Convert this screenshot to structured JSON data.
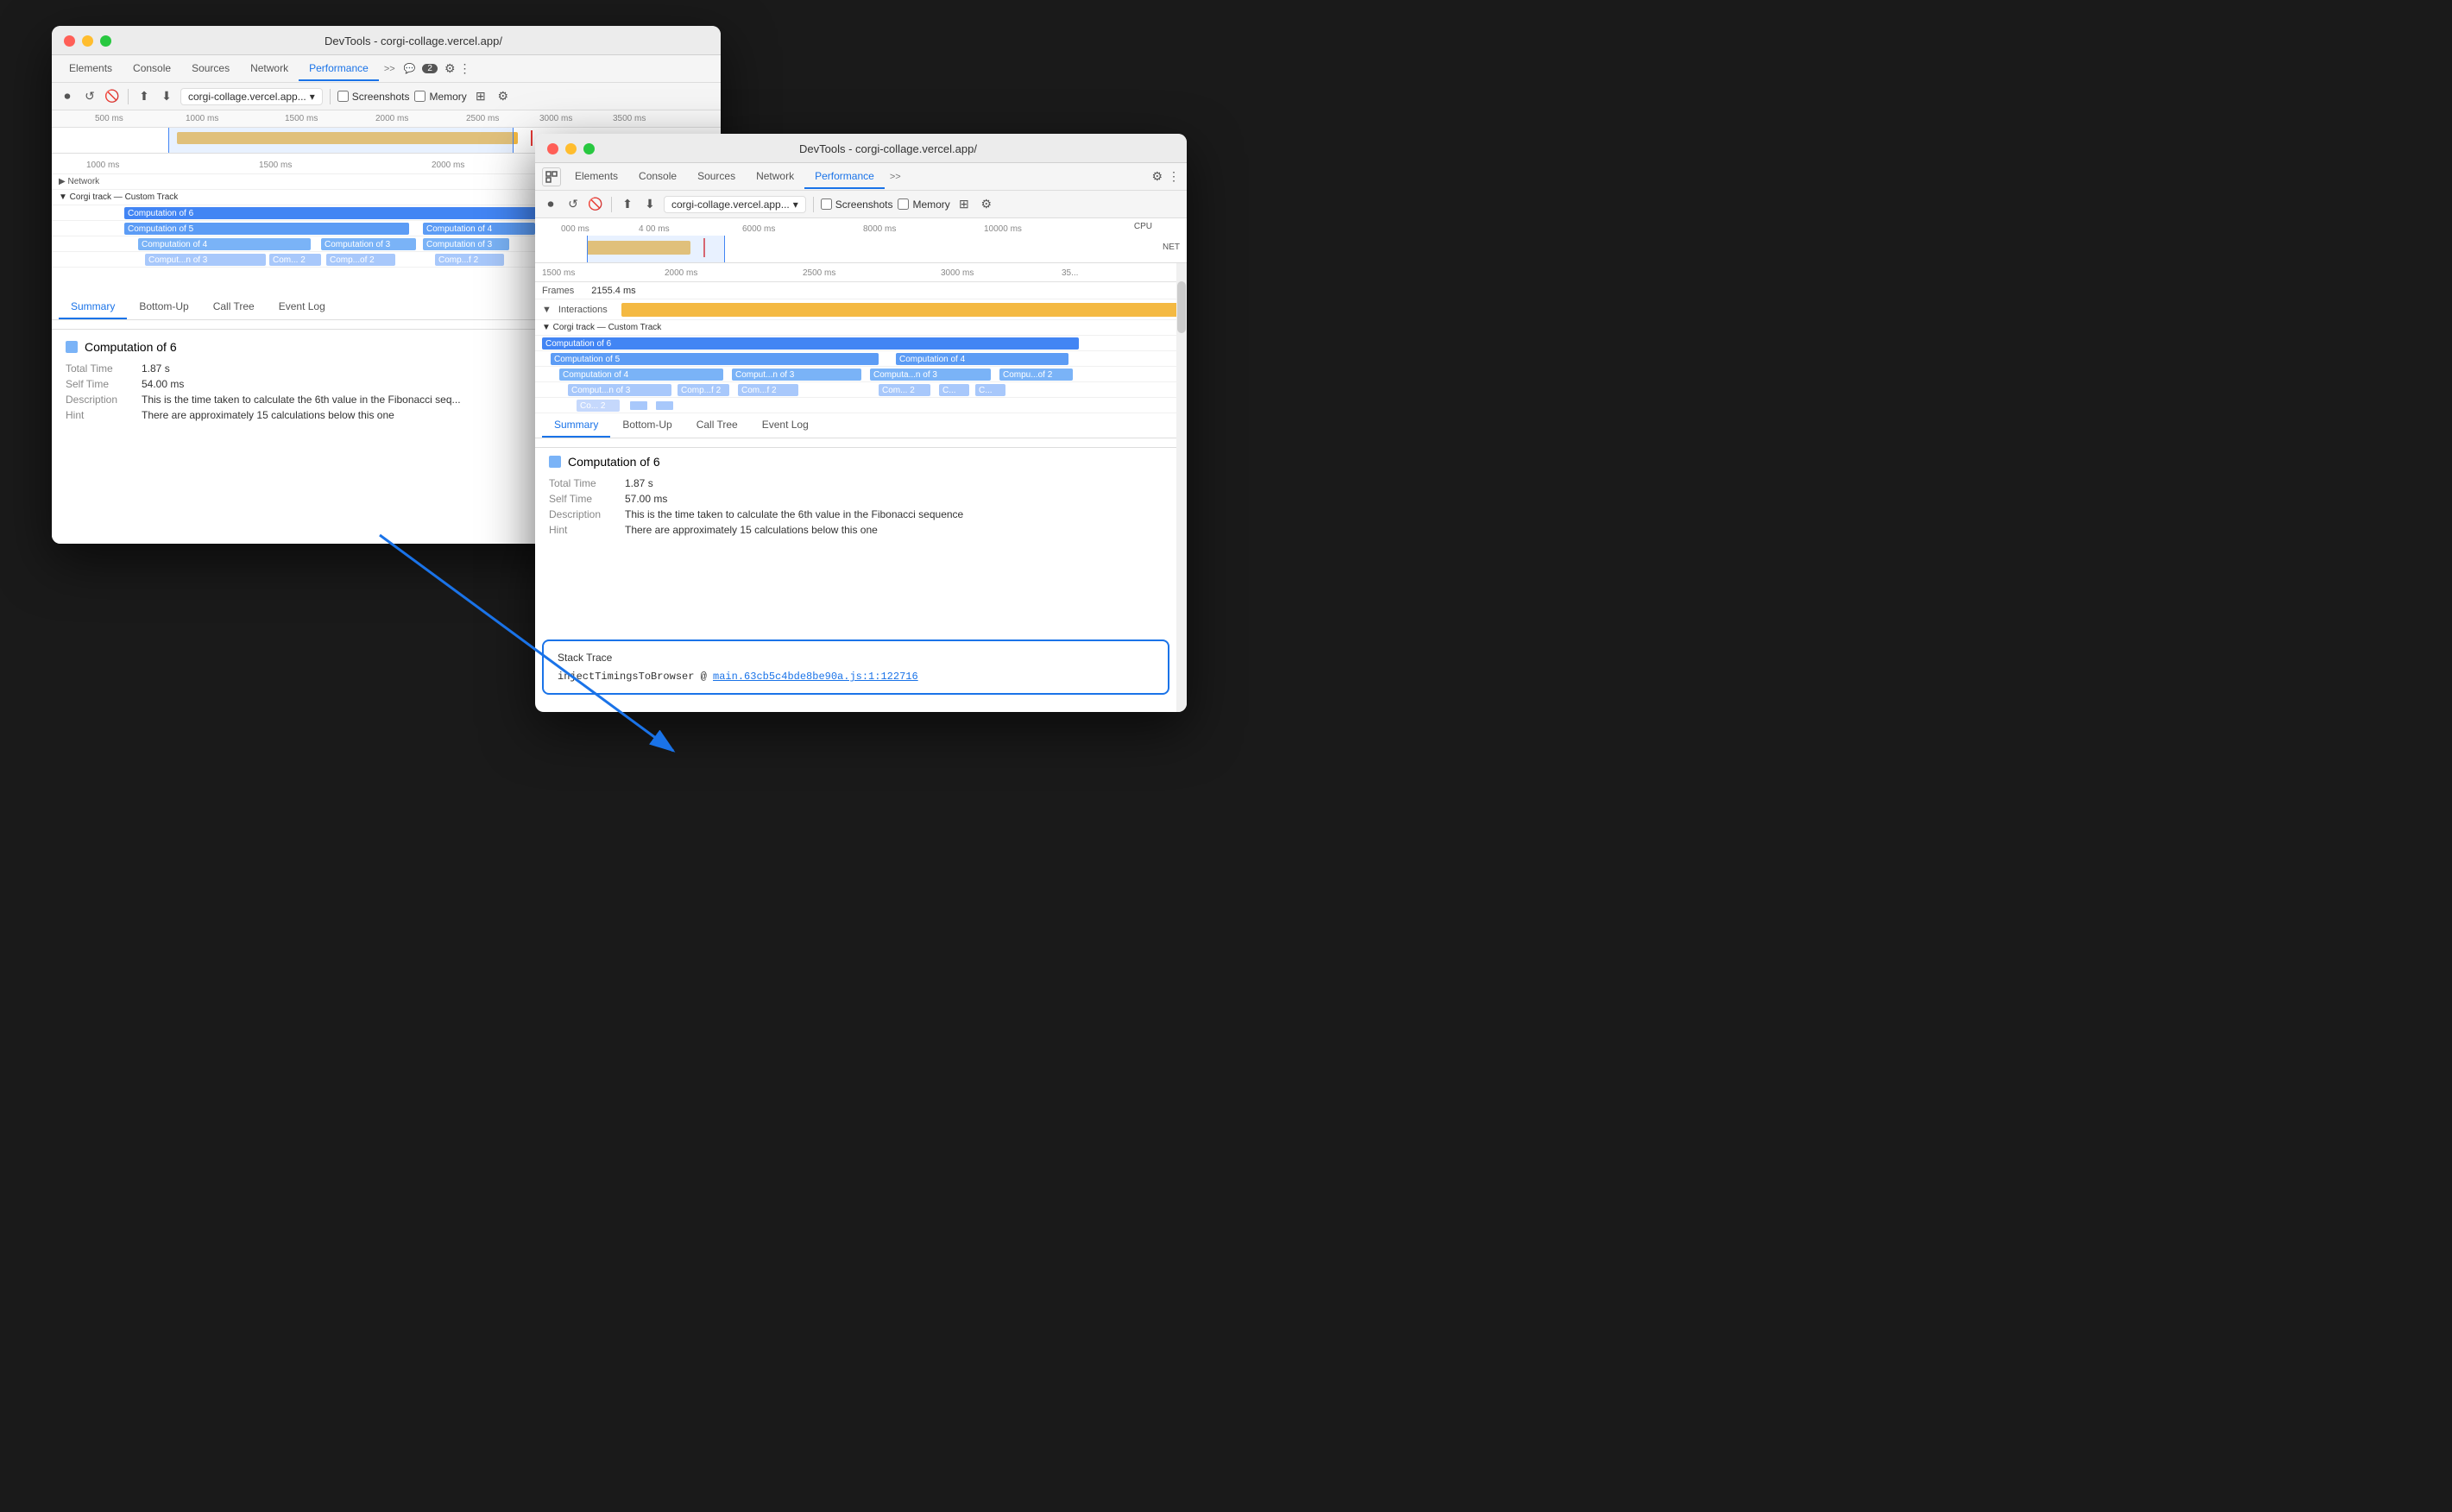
{
  "win1": {
    "title": "DevTools - corgi-collage.vercel.app/",
    "tabs": [
      "Elements",
      "Console",
      "Sources",
      "Network",
      "Performance",
      ">>"
    ],
    "performance_tab": "Performance",
    "badge": "2",
    "url": "corgi-collage.vercel.app...",
    "checkboxes": [
      "Screenshots",
      "Memory"
    ],
    "time_ticks": [
      "500 ms",
      "1000 ms",
      "1500 ms",
      "2000 ms",
      "2500 ms",
      "3000 ms",
      "3500 ms"
    ],
    "ruler_ticks2": [
      "1000 ms",
      "1500 ms",
      "2000 ms"
    ],
    "network_label": "Network",
    "custom_track_label": "Corgi track — Custom Track",
    "bars": {
      "comp6": "Computation of 6",
      "comp5": "Computation of 5",
      "comp4a": "Computation of 4",
      "comp4b": "Computation of 4",
      "comp3a": "Computation of 3",
      "comp3b": "Computation of 3",
      "comp3c": "Comput...n of 3",
      "comp3d": "Com... 2",
      "comp2a": "Comp...of 2",
      "comp2b": "Comp...f 2"
    },
    "summary_tabs": [
      "Summary",
      "Bottom-Up",
      "Call Tree",
      "Event Log"
    ],
    "summary_title": "Computation of 6",
    "total_time_label": "Total Time",
    "total_time_val": "1.87 s",
    "self_time_label": "Self Time",
    "self_time_val": "54.00 ms",
    "description_label": "Description",
    "description_val": "This is the time taken to calculate the 6th value in the Fibonacci seq...",
    "hint_label": "Hint",
    "hint_val": "There are approximately 15 calculations below this one"
  },
  "win2": {
    "title": "DevTools - corgi-collage.vercel.app/",
    "tabs": [
      "Elements",
      "Console",
      "Sources",
      "Network",
      "Performance",
      ">>"
    ],
    "performance_tab": "Performance",
    "url": "corgi-collage.vercel.app...",
    "checkboxes": [
      "Screenshots",
      "Memory"
    ],
    "time_ticks_top": [
      "000 ms",
      "4 00 ms",
      "6000 ms",
      "8000 ms",
      "10000 ms"
    ],
    "time_ticks_main": [
      "1500 ms",
      "2000 ms",
      "2500 ms",
      "3000 ms",
      "35..."
    ],
    "frames_label": "Frames",
    "frames_val": "2155.4 ms",
    "interactions_label": "Interactions",
    "custom_track_label": "Corgi track — Custom Track",
    "bars": {
      "comp6": "Computation of 6",
      "comp5": "Computation of 5",
      "comp4a": "Computation of 4",
      "comp4b": "Computation of 4",
      "comp3a": "Computation of 4",
      "comp3b": "Comput...n of 3",
      "comp3c": "Computa...n of 3",
      "comp3d": "Compu...of 2",
      "comp3e": "Comput...n of 3",
      "comp3f": "Comp...f 2",
      "comp3g": "Com...f 2",
      "comp3h": "Com... 2",
      "comp3i": "C...",
      "comp3j": "C...",
      "co2a": "Co... 2"
    },
    "summary_tabs": [
      "Summary",
      "Bottom-Up",
      "Call Tree",
      "Event Log"
    ],
    "summary_title": "Computation of 6",
    "total_time_label": "Total Time",
    "total_time_val": "1.87 s",
    "self_time_label": "Self Time",
    "self_time_val": "57.00 ms",
    "description_label": "Description",
    "description_val": "This is the time taken to calculate the 6th value in the Fibonacci sequence",
    "hint_label": "Hint",
    "hint_val": "There are approximately 15 calculations below this one",
    "stack_trace_title": "Stack Trace",
    "stack_trace_code": "injectTimingsToBrowser @ ",
    "stack_trace_link": "main.63cb5c4bde8be90a.js:1:122716",
    "cpu_label": "CPU",
    "net_label": "NET"
  }
}
